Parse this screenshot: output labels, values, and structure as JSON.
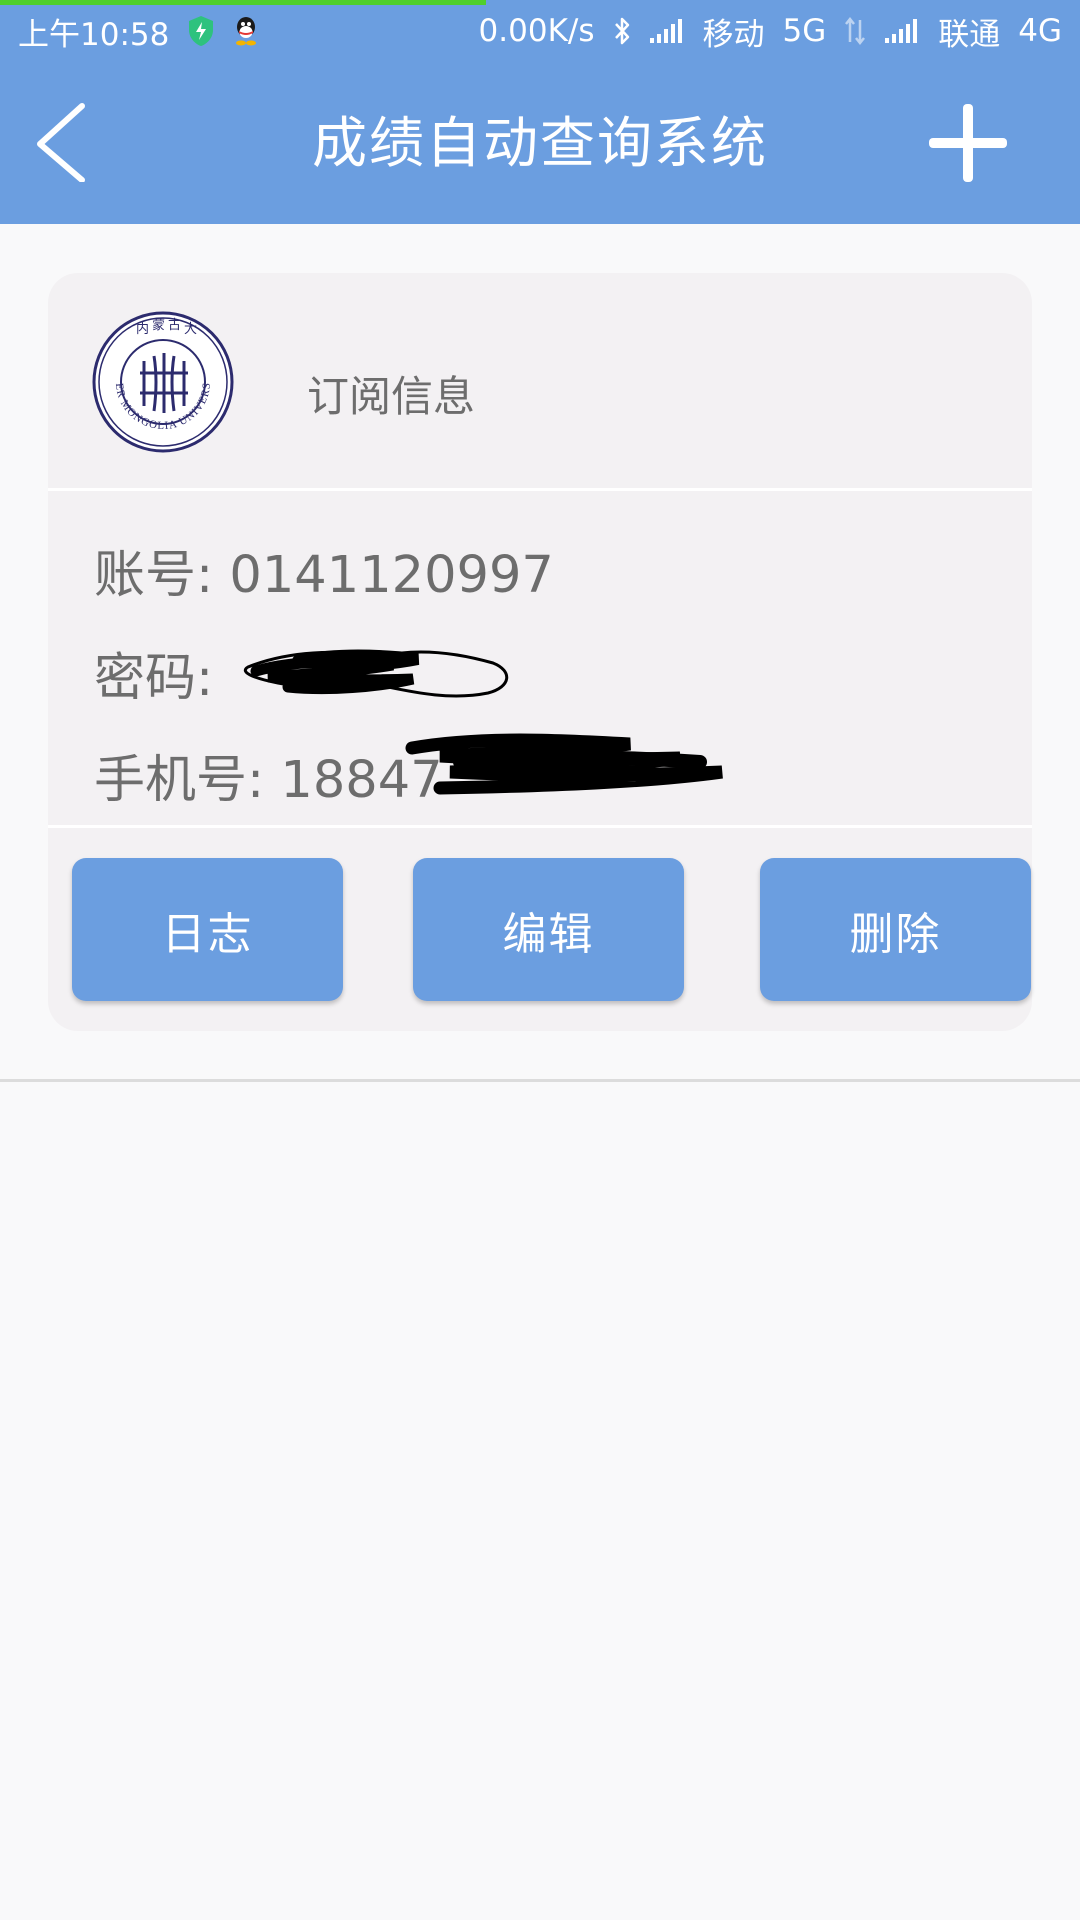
{
  "status_bar": {
    "time": "上午10:58",
    "network_speed": "0.00K/s",
    "carrier1": "移动",
    "carrier1_type": "5G",
    "carrier2": "联通",
    "carrier2_type": "4G",
    "icons": [
      "shield-icon",
      "qq-icon",
      "bluetooth-icon",
      "signal-icon",
      "data-arrows-icon",
      "signal-icon"
    ],
    "page_load_progress": 0.45,
    "progress_color": "#4fcf2c"
  },
  "app_bar": {
    "title": "成绩自动查询系统",
    "back_icon": "chevron-left-icon",
    "add_icon": "plus-icon",
    "background_color": "#6b9ee0"
  },
  "subscription_card": {
    "header_title": "订阅信息",
    "logo_icon": "inner-mongolia-university-seal",
    "logo_text": "INNER MONGOLIA UNIVERSITY",
    "account_label": "账号:",
    "account_value": "0141120997",
    "password_label": "密码:",
    "password_value": "",
    "phone_label": "手机号:",
    "phone_value": "18847",
    "buttons": {
      "log": "日志",
      "edit": "编辑",
      "delete": "删除"
    },
    "button_color": "#6b9ee0"
  }
}
